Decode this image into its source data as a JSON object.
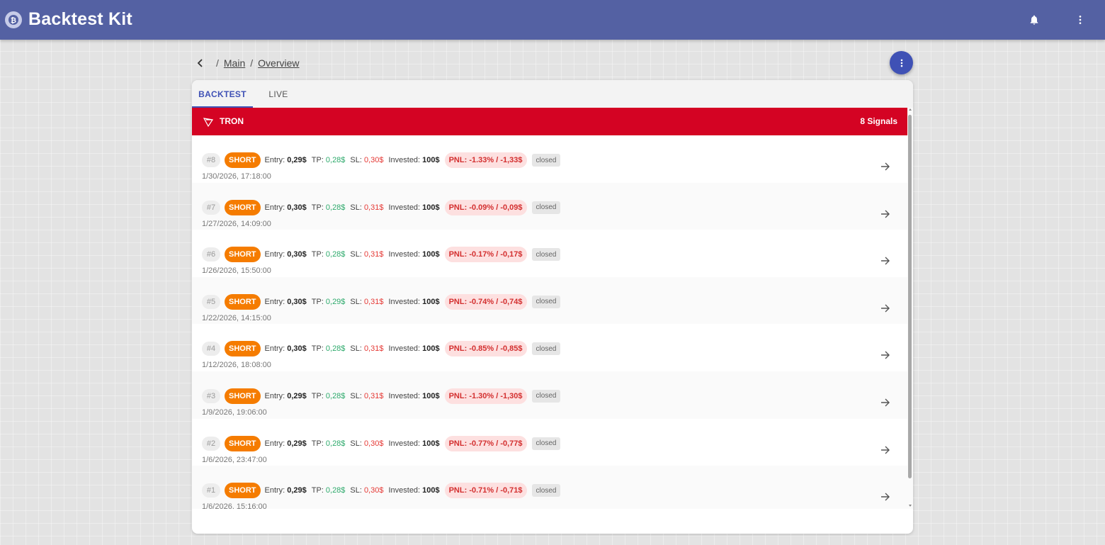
{
  "app": {
    "title": "Backtest Kit"
  },
  "breadcrumb": {
    "items": [
      "Main",
      "Overview"
    ],
    "separator": "/"
  },
  "tabs": [
    {
      "label": "BACKTEST",
      "active": true
    },
    {
      "label": "LIVE",
      "active": false
    }
  ],
  "group": {
    "name": "TRON",
    "count_label": "8 Signals",
    "color": "#d40323"
  },
  "labels": {
    "entry": "Entry:",
    "tp": "TP:",
    "sl": "SL:",
    "invested": "Invested:"
  },
  "signals": [
    {
      "num": "#8",
      "side": "SHORT",
      "entry": "0,29$",
      "tp": "0,28$",
      "sl": "0,30$",
      "invested": "100$",
      "pnl": "PNL: -1.33% / -1,33$",
      "status": "closed",
      "date": "1/30/2026, 17:18:00"
    },
    {
      "num": "#7",
      "side": "SHORT",
      "entry": "0,30$",
      "tp": "0,28$",
      "sl": "0,31$",
      "invested": "100$",
      "pnl": "PNL: -0.09% / -0,09$",
      "status": "closed",
      "date": "1/27/2026, 14:09:00"
    },
    {
      "num": "#6",
      "side": "SHORT",
      "entry": "0,30$",
      "tp": "0,28$",
      "sl": "0,31$",
      "invested": "100$",
      "pnl": "PNL: -0.17% / -0,17$",
      "status": "closed",
      "date": "1/26/2026, 15:50:00"
    },
    {
      "num": "#5",
      "side": "SHORT",
      "entry": "0,30$",
      "tp": "0,29$",
      "sl": "0,31$",
      "invested": "100$",
      "pnl": "PNL: -0.74% / -0,74$",
      "status": "closed",
      "date": "1/22/2026, 14:15:00"
    },
    {
      "num": "#4",
      "side": "SHORT",
      "entry": "0,30$",
      "tp": "0,28$",
      "sl": "0,31$",
      "invested": "100$",
      "pnl": "PNL: -0.85% / -0,85$",
      "status": "closed",
      "date": "1/12/2026, 18:08:00"
    },
    {
      "num": "#3",
      "side": "SHORT",
      "entry": "0,29$",
      "tp": "0,28$",
      "sl": "0,31$",
      "invested": "100$",
      "pnl": "PNL: -1.30% / -1,30$",
      "status": "closed",
      "date": "1/9/2026, 19:06:00"
    },
    {
      "num": "#2",
      "side": "SHORT",
      "entry": "0,29$",
      "tp": "0,28$",
      "sl": "0,30$",
      "invested": "100$",
      "pnl": "PNL: -0.77% / -0,77$",
      "status": "closed",
      "date": "1/6/2026, 23:47:00"
    },
    {
      "num": "#1",
      "side": "SHORT",
      "entry": "0,29$",
      "tp": "0,28$",
      "sl": "0,30$",
      "invested": "100$",
      "pnl": "PNL: -0.71% / -0,71$",
      "status": "closed",
      "date": "1/6/2026, 15:16:00"
    }
  ],
  "icons": {
    "logo": "logo-icon",
    "notifications": "bell-icon",
    "menu": "more-vert-icon",
    "back": "chevron-left-icon",
    "row_action": "arrow-right-icon",
    "group": "tron-icon"
  },
  "colors": {
    "appbar": "#5461a3",
    "accent": "#3f51b5",
    "short": "#f57c00",
    "tp": "#2eaa6c",
    "sl": "#e53935",
    "pnl_negative_bg": "#fde0e0"
  }
}
